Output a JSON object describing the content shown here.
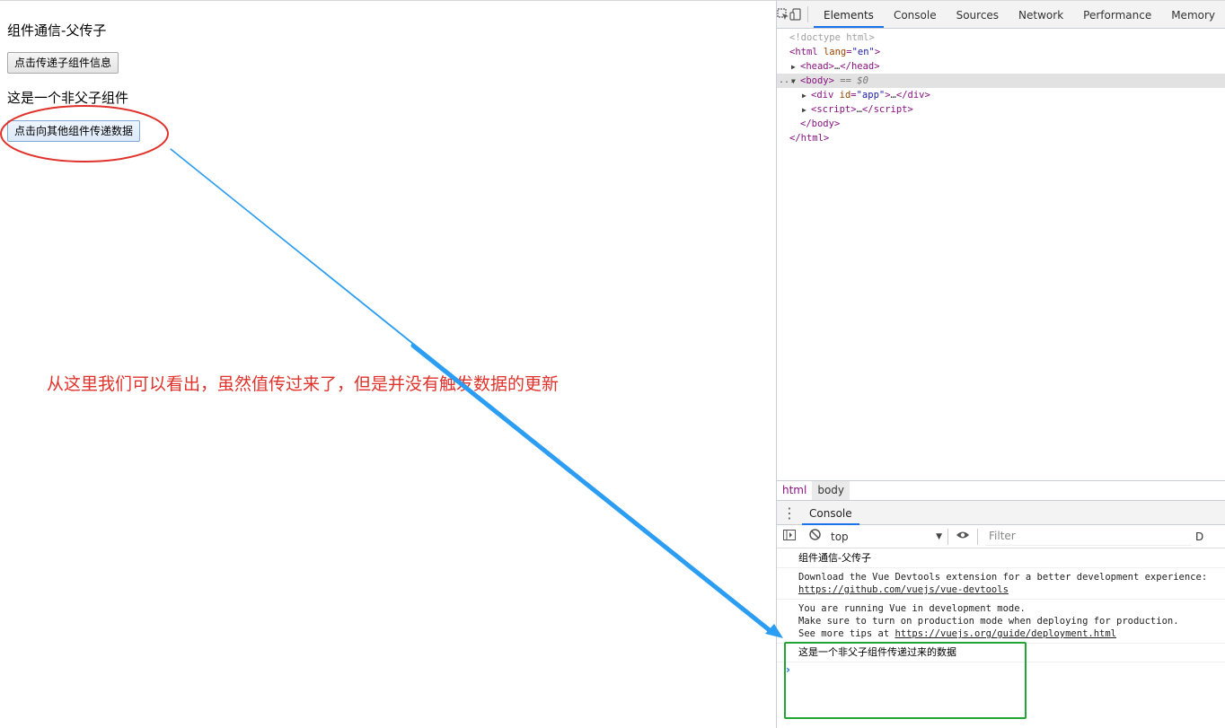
{
  "page": {
    "title": "组件通信-父传子",
    "button_send_child": "点击传递子组件信息",
    "section_label": "这是一个非父子组件",
    "button_send_other": "点击向其他组件传递数据",
    "annotation": "从这里我们可以看出，虽然值传过来了，但是并没有触发数据的更新"
  },
  "annotation_colors": {
    "circle": "#e0322b",
    "arrow": "#2b9df3",
    "box": "#22a633",
    "text": "#e0322b"
  },
  "devtools": {
    "tabs": [
      "Elements",
      "Console",
      "Sources",
      "Network",
      "Performance",
      "Memory"
    ],
    "active_tab": "Elements",
    "icons": [
      "inspect-icon",
      "device-toggle-icon"
    ],
    "elements": {
      "doctype": "<!doctype html>",
      "html_open_tag": "html",
      "html_attr": "lang",
      "html_attr_val": "\"en\"",
      "head": "head",
      "body": "body",
      "body_eq": "== $0",
      "ellipsis_gutter": "...",
      "div": "div",
      "div_attr": "id",
      "div_attr_val": "\"app\"",
      "script": "script",
      "collapsed": "…",
      "body_close": "</body>",
      "html_close": "</html>"
    },
    "breadcrumb": [
      "html",
      "body"
    ],
    "drawer_tab": "Console",
    "console_toolbar": {
      "context": "top",
      "filter_placeholder": "Filter",
      "level": "D"
    },
    "console_messages": {
      "m1": "组件通信-父传子",
      "m2_line1": "Download the Vue Devtools extension for a better development experience:",
      "m2_link": "https://github.com/vuejs/vue-devtools",
      "m3_line1": "You are running Vue in development mode.",
      "m3_line2": "Make sure to turn on production mode when deploying for production.",
      "m3_line3_prefix": "See more tips at ",
      "m3_link": "https://vuejs.org/guide/deployment.html",
      "m4": "这是一个非父子组件传递过来的数据",
      "prompt": "›"
    }
  }
}
